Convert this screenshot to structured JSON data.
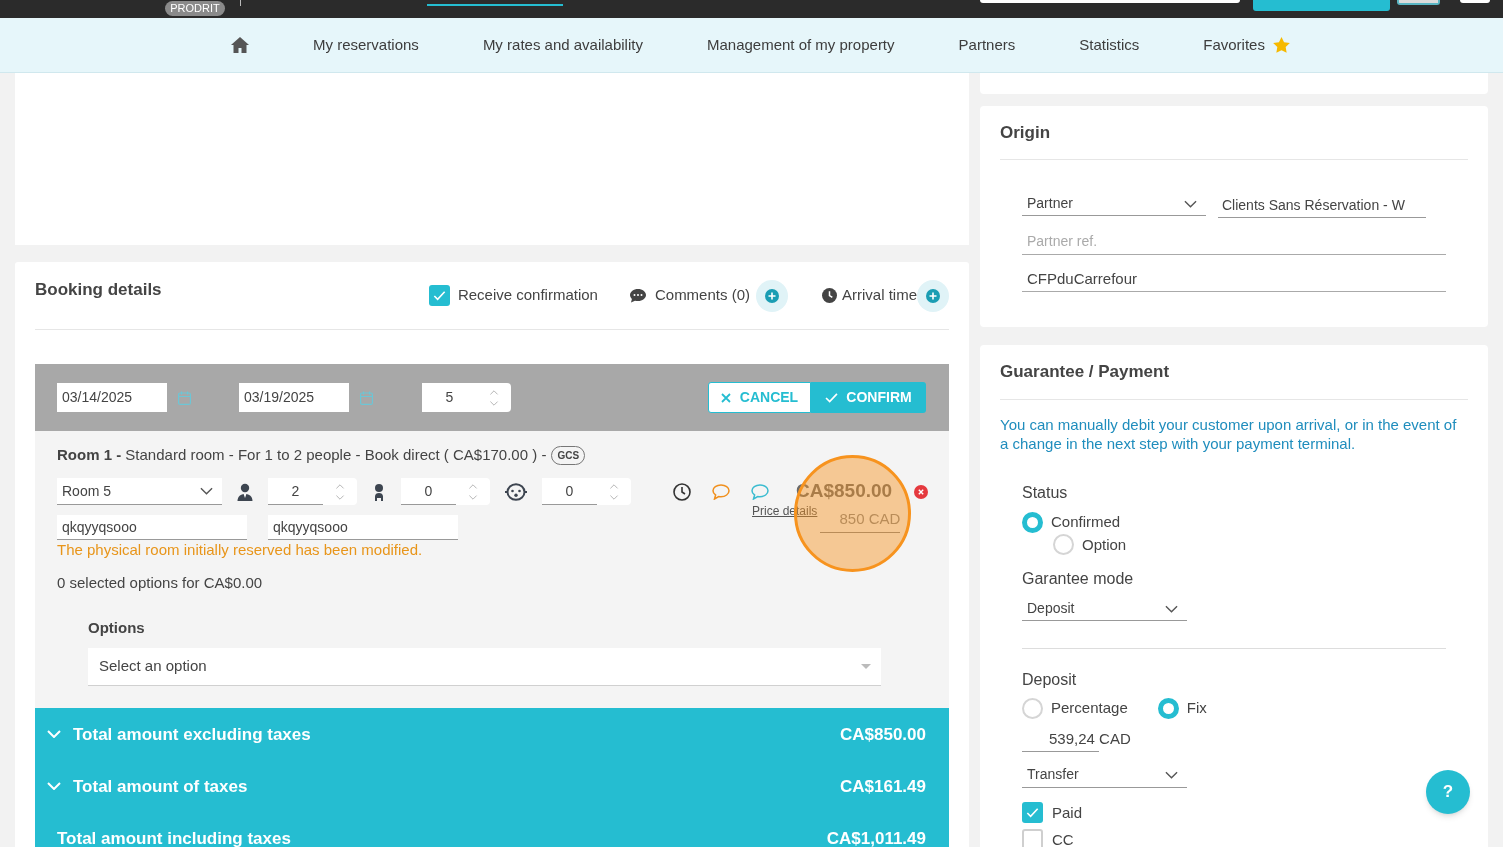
{
  "header": {
    "badge": "PRODRIT"
  },
  "nav": {
    "items": [
      {
        "kind": "link",
        "label": "My reservations"
      },
      {
        "kind": "link",
        "label": "My rates and availability"
      },
      {
        "kind": "link",
        "label": "Management of my property"
      },
      {
        "kind": "link",
        "label": "Partners"
      },
      {
        "kind": "link",
        "label": "Statistics"
      },
      {
        "kind": "favorites",
        "label": "Favorites"
      }
    ]
  },
  "booking": {
    "title": "Booking details",
    "receive_confirmation": {
      "label": "Receive confirmation",
      "checked": true
    },
    "comments": {
      "label": "Comments (0)"
    },
    "arrival_time": {
      "label": "Arrival time"
    },
    "stay": {
      "arrival": "03/14/2025",
      "departure": "03/19/2025",
      "nights": "5"
    },
    "actions": [
      {
        "kind": "cancel",
        "label": "CANCEL"
      },
      {
        "kind": "confirm",
        "label": "CONFIRM"
      }
    ],
    "room": {
      "title": "**Room 1 -** Standard room - For 1 to 2 people - Book direct ( CA$170.00 ) -",
      "badge": "GCS",
      "room_select": "Room 5",
      "occupants": [
        {
          "kind": "adult",
          "value": "2"
        },
        {
          "kind": "child",
          "value": "0"
        },
        {
          "kind": "baby",
          "value": "0"
        }
      ],
      "price": "CA$850.00",
      "price_details": "Price details",
      "price_input": "850 CAD",
      "guest_names": [
        "qkqyyqsooo",
        "qkqyyqsooo"
      ],
      "warning": "The physical room initially reserved has been modified.",
      "options_summary": "0 selected options for CA$0.00",
      "options": {
        "label": "Options",
        "placeholder": "Select an option"
      }
    },
    "totals": [
      {
        "kind": "collapsible",
        "label": "Total amount excluding taxes",
        "value": "CA$850.00"
      },
      {
        "kind": "collapsible",
        "label": "Total amount of taxes",
        "value": "CA$161.49"
      },
      {
        "kind": "total",
        "label": "Total amount including taxes",
        "value": "CA$1,011.49"
      }
    ]
  },
  "origin": {
    "title": "Origin",
    "partner_type": "Partner",
    "partner_name": "Clients Sans Réservation - W",
    "partner_ref": {
      "placeholder": "Partner ref."
    },
    "reference": "CFPduCarrefour"
  },
  "guarantee": {
    "title": "Guarantee / Payment",
    "info": "You can manually debit your customer upon arrival, or in the event of a change in the next step with your payment terminal.",
    "status": {
      "label": "Status",
      "options": [
        {
          "label": "Confirmed",
          "selected": true
        },
        {
          "label": "Option",
          "selected": false
        }
      ]
    },
    "mode": {
      "label": "Garantee mode",
      "value": "Deposit"
    },
    "deposit": {
      "label": "Deposit",
      "options": [
        {
          "label": "Percentage",
          "selected": false
        },
        {
          "label": "Fix",
          "selected": true
        }
      ],
      "amount": "539,24 CAD",
      "method": "Transfer"
    },
    "checks": [
      {
        "label": "Paid",
        "checked": true
      },
      {
        "label": "CC",
        "checked": false
      }
    ]
  },
  "help_button": {
    "label": "?"
  }
}
